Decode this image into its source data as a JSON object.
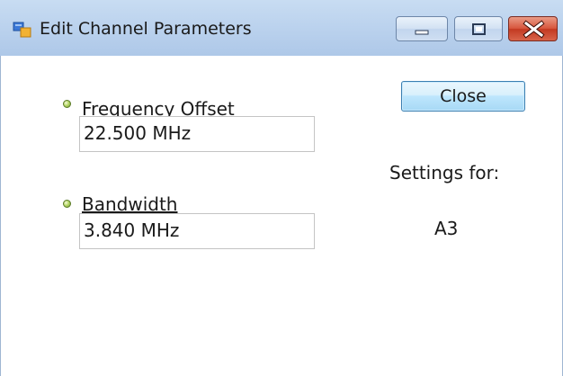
{
  "window": {
    "title": "Edit Channel Parameters",
    "buttons": {
      "minimize": "minimize",
      "maximize": "maximize",
      "close": "close"
    }
  },
  "form": {
    "frequency_offset": {
      "label": "Frequency Offset",
      "value": "22.500 MHz"
    },
    "bandwidth": {
      "label": "Bandwidth",
      "value": "3.840 MHz"
    }
  },
  "actions": {
    "close_label": "Close"
  },
  "settings": {
    "label": "Settings for:",
    "channel": "A3"
  },
  "colors": {
    "titlebar": "#bcd3ee",
    "close_caption": "#d8573e",
    "button_border": "#3c7fb1",
    "bullet": "#b8d86a"
  }
}
